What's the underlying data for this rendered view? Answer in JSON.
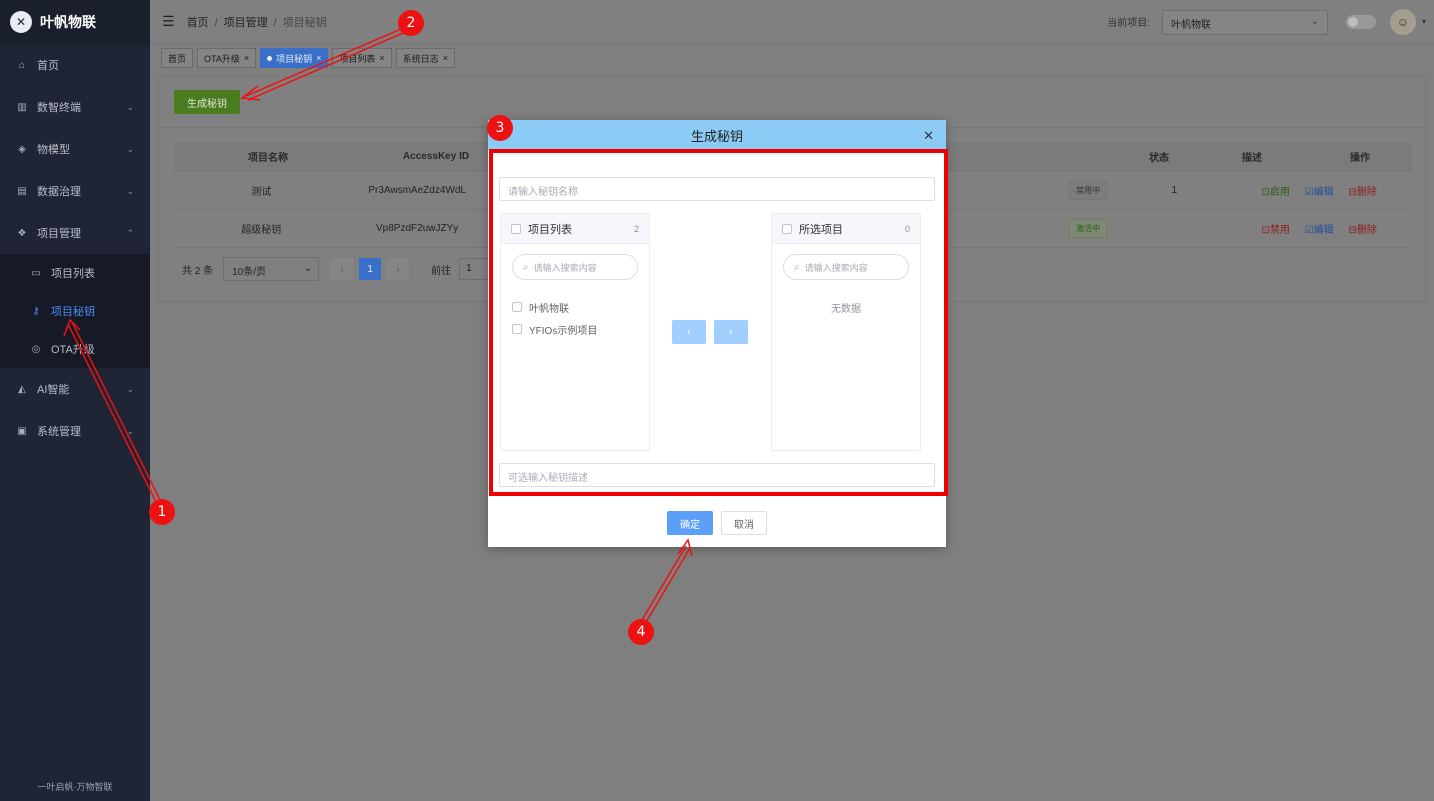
{
  "brand": {
    "name": "叶帆物联"
  },
  "sidebar": {
    "items": [
      {
        "label": "首页",
        "icon": "home-icon"
      },
      {
        "label": "数智终端",
        "icon": "chart-icon"
      },
      {
        "label": "物模型",
        "icon": "model-icon"
      },
      {
        "label": "数据治理",
        "icon": "doc-icon"
      },
      {
        "label": "项目管理",
        "icon": "project-icon"
      },
      {
        "label": "AI智能",
        "icon": "ai-icon"
      },
      {
        "label": "系统管理",
        "icon": "system-icon"
      }
    ],
    "sub": [
      {
        "label": "项目列表",
        "icon": "folder-icon"
      },
      {
        "label": "项目秘钥",
        "icon": "key-icon"
      },
      {
        "label": "OTA升级",
        "icon": "ota-icon"
      }
    ],
    "footer": "一叶启帆·万物智联"
  },
  "header": {
    "breadcrumb": [
      "首页",
      "项目管理",
      "项目秘钥"
    ],
    "project_label": "当前项目:",
    "project_value": "叶帆物联"
  },
  "tabs": [
    "首页",
    "OTA升级",
    "项目秘钥",
    "项目列表",
    "系统日志"
  ],
  "toolbar": {
    "generate_label": "生成秘钥"
  },
  "table": {
    "headers": [
      "项目名称",
      "AccessKey ID",
      "状态",
      "描述",
      "操作"
    ],
    "rows": [
      {
        "name": "测试",
        "key": "Pr3AwsmAeZdz4WdL",
        "status": "禁用中",
        "desc": "1",
        "toggle": "启用"
      },
      {
        "name": "超级秘钥",
        "key": "Vp8PzdF2uwJZYy",
        "status": "激活中",
        "desc": "",
        "toggle": "禁用"
      }
    ],
    "edit_label": "编辑",
    "delete_label": "删除"
  },
  "pager": {
    "total": "共 2 条",
    "size": "10条/页",
    "current": "1",
    "goto": "前往",
    "goto_value": "1"
  },
  "modal": {
    "title": "生成秘钥",
    "name_placeholder": "请输入秘钥名称",
    "left_title": "项目列表",
    "left_count": "2",
    "right_title": "所选项目",
    "right_count": "0",
    "search_placeholder": "请输入搜索内容",
    "left_items": [
      "叶帆物联",
      "YFIOs示例项目"
    ],
    "empty": "无数据",
    "desc_placeholder": "可选输入秘钥描述",
    "ok": "确定",
    "cancel": "取消"
  },
  "annotations": [
    "1",
    "2",
    "3",
    "4"
  ],
  "colors": {
    "annotation": "#ee1111",
    "primary": "#5b9ff7",
    "success": "#4a7b1f"
  }
}
